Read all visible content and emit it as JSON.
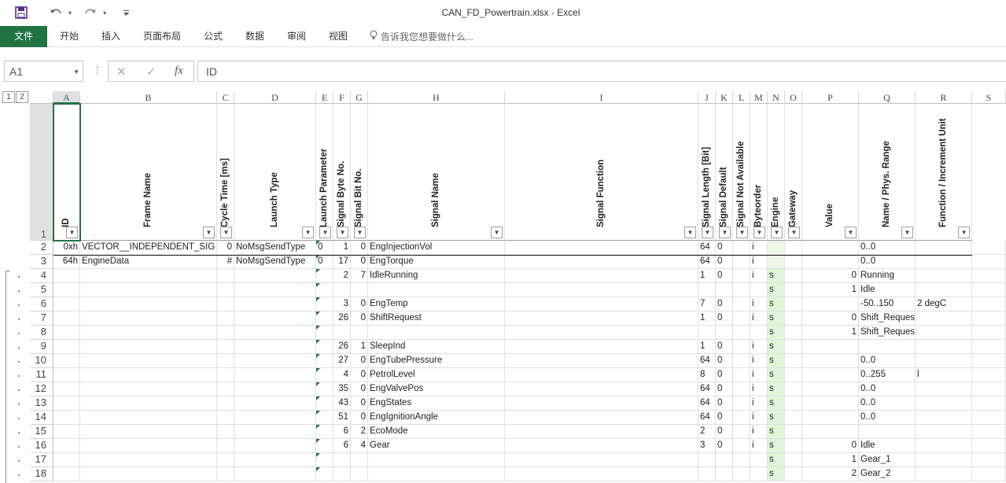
{
  "window": {
    "title": "CAN_FD_Powertrain.xlsx - Excel"
  },
  "quick_access": {
    "save_icon": "save-icon",
    "undo_icon": "undo-icon",
    "redo_icon": "redo-icon"
  },
  "ribbon": {
    "tabs": [
      "文件",
      "开始",
      "插入",
      "页面布局",
      "公式",
      "数据",
      "审阅",
      "视图"
    ],
    "tell_me": "告诉我您想要做什么..."
  },
  "formula_bar": {
    "name_box": "A1",
    "formula": "ID",
    "cancel": "✕",
    "enter": "✓",
    "fx": "fx"
  },
  "outline_buttons": [
    "1",
    "2"
  ],
  "columns": [
    "A",
    "B",
    "C",
    "D",
    "E",
    "F",
    "G",
    "H",
    "I",
    "J",
    "K",
    "L",
    "M",
    "N",
    "O",
    "P",
    "Q",
    "R",
    "S"
  ],
  "header_row": {
    "row_number": "1",
    "labels": [
      "ID",
      "Frame Name",
      "Cycle Time [ms]",
      "Launch Type",
      "Launch Parameter",
      "Signal Byte No.",
      "Signal Bit No.",
      "Signal Name",
      "Signal Function",
      "Signal Length [Bit]",
      "Signal Default",
      "Signal Not Available",
      "Byteorder",
      "Engine",
      "Gateway",
      "Value",
      "Name / Phys. Range",
      "Function / Increment Unit"
    ]
  },
  "rows": [
    {
      "n": "2",
      "cells": {
        "A": "0xh",
        "B": "VECTOR__INDEPENDENT_SIG",
        "C": "0",
        "D": "NoMsgSendType",
        "E": "0",
        "F": "1",
        "G": "0",
        "H": "EngInjectionVol",
        "J": "64",
        "K": "0",
        "M": "i",
        "Q": "0..0"
      }
    },
    {
      "n": "3",
      "cells": {
        "A": "64h",
        "B": "EngineData",
        "C": "#",
        "D": "NoMsgSendType",
        "E": "0",
        "F": "17",
        "G": "0",
        "H": "EngTorque",
        "J": "64",
        "K": "0",
        "M": "i",
        "Q": "0..0"
      }
    },
    {
      "n": "4",
      "cells": {
        "F": "2",
        "G": "7",
        "H": "IdleRunning",
        "J": "1",
        "K": "0",
        "M": "i",
        "N": "s",
        "P": "0",
        "Q": "Running"
      }
    },
    {
      "n": "5",
      "cells": {
        "N": "s",
        "P": "1",
        "Q": "Idle"
      }
    },
    {
      "n": "6",
      "cells": {
        "F": "3",
        "G": "0",
        "H": "EngTemp",
        "J": "7",
        "K": "0",
        "M": "i",
        "N": "s",
        "Q": "-50..150",
        "R": "2  degC"
      }
    },
    {
      "n": "7",
      "cells": {
        "F": "26",
        "G": "0",
        "H": "ShiftRequest",
        "J": "1",
        "K": "0",
        "M": "i",
        "N": "s",
        "P": "0",
        "Q": "Shift_Request_Off"
      }
    },
    {
      "n": "8",
      "cells": {
        "N": "s",
        "P": "1",
        "Q": "Shift_Request_On"
      }
    },
    {
      "n": "9",
      "cells": {
        "F": "26",
        "G": "1",
        "H": "SleepInd",
        "J": "1",
        "K": "0",
        "M": "i",
        "N": "s"
      }
    },
    {
      "n": "10",
      "cells": {
        "F": "27",
        "G": "0",
        "H": "EngTubePressure",
        "J": "64",
        "K": "0",
        "M": "i",
        "N": "s",
        "Q": "0..0"
      }
    },
    {
      "n": "11",
      "cells": {
        "F": "4",
        "G": "0",
        "H": "PetrolLevel",
        "J": "8",
        "K": "0",
        "M": "i",
        "N": "s",
        "Q": "0..255",
        "R": "l"
      }
    },
    {
      "n": "12",
      "cells": {
        "F": "35",
        "G": "0",
        "H": "EngValvePos",
        "J": "64",
        "K": "0",
        "M": "i",
        "N": "s",
        "Q": "0..0"
      }
    },
    {
      "n": "13",
      "cells": {
        "F": "43",
        "G": "0",
        "H": "EngStates",
        "J": "64",
        "K": "0",
        "M": "i",
        "N": "s",
        "Q": "0..0"
      }
    },
    {
      "n": "14",
      "cells": {
        "F": "51",
        "G": "0",
        "H": "EngIgnitionAngle",
        "J": "64",
        "K": "0",
        "M": "i",
        "N": "s",
        "Q": "0..0"
      }
    },
    {
      "n": "15",
      "cells": {
        "F": "6",
        "G": "2",
        "H": "EcoMode",
        "J": "2",
        "K": "0",
        "M": "i",
        "N": "s"
      }
    },
    {
      "n": "16",
      "cells": {
        "F": "6",
        "G": "4",
        "H": "Gear",
        "J": "3",
        "K": "0",
        "M": "i",
        "N": "s",
        "P": "0",
        "Q": "Idle"
      }
    },
    {
      "n": "17",
      "cells": {
        "N": "s",
        "P": "1",
        "Q": "Gear_1"
      }
    },
    {
      "n": "18",
      "cells": {
        "N": "s",
        "P": "2",
        "Q": "Gear_2"
      }
    }
  ],
  "colors": {
    "excel_green": "#217346",
    "highlight_green": "#e2f5d8"
  }
}
